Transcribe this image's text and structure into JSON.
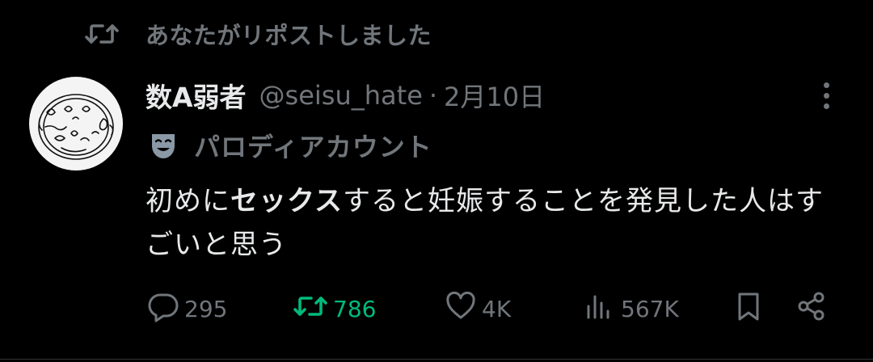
{
  "repost_banner": {
    "text": "あなたがリポストしました"
  },
  "author": {
    "name": "数A弱者",
    "handle": "@seisu_hate",
    "separator": "·",
    "date": "2月10日"
  },
  "parody_label": "パロディアカウント",
  "tweet": {
    "text_part1": "初めに",
    "text_bold": "セックス",
    "text_part2": "すると妊娠することを発見した人はすごいと思う"
  },
  "actions": {
    "replies": "295",
    "reposts": "786",
    "likes": "4K",
    "views": "567K"
  },
  "colors": {
    "background": "#000000",
    "text_primary": "#e7e9ea",
    "text_secondary": "#71767b",
    "repost_active": "#00ba7c"
  },
  "icons": [
    "repost-icon",
    "mask-icon",
    "more-icon",
    "reply-icon",
    "like-icon",
    "views-icon",
    "bookmark-icon",
    "share-icon"
  ]
}
